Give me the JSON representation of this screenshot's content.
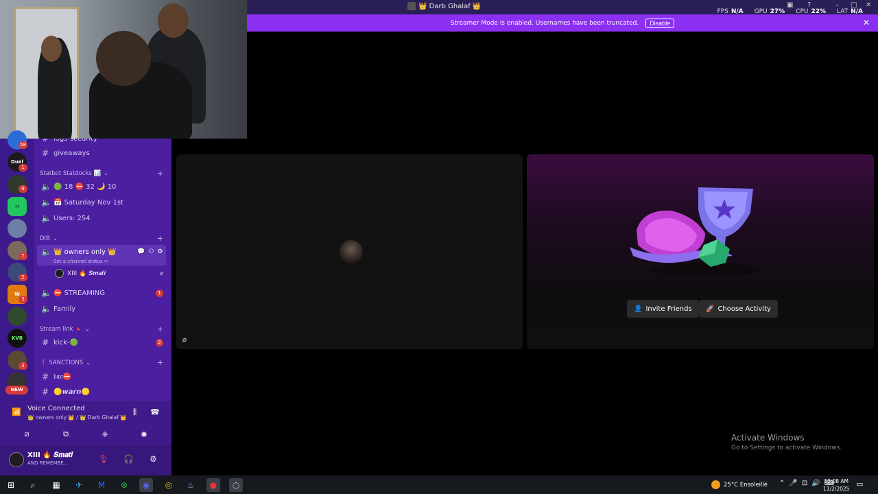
{
  "titlebar": {
    "title": "👑 Darb Ghalaf 👑",
    "stats": [
      {
        "label": "FPS",
        "value": "N/A"
      },
      {
        "label": "GPU",
        "value": "27%"
      },
      {
        "label": "CPU",
        "value": "22%"
      },
      {
        "label": "LAT",
        "value": "N/A"
      }
    ]
  },
  "streamer_mode": {
    "message": "Streamer Mode is enabled. Usernames have been truncated.",
    "disable_label": "Disable"
  },
  "servers": [
    {
      "label": "",
      "badge": "58"
    },
    {
      "label": "Duel",
      "badge": "1"
    },
    {
      "label": "",
      "badge": "9"
    },
    {
      "label": "H",
      "badge": ""
    },
    {
      "label": "",
      "badge": ""
    },
    {
      "label": "",
      "badge": "7"
    },
    {
      "label": "",
      "badge": "2"
    },
    {
      "label": "W",
      "badge": "3"
    },
    {
      "label": "",
      "badge": ""
    },
    {
      "label": "KVB",
      "badge": ""
    },
    {
      "label": "",
      "badge": "3"
    },
    {
      "label": "",
      "badge": ""
    }
  ],
  "new_badge": "NEW",
  "channels": {
    "top_cut": "logs-security",
    "giveaways": "giveaways",
    "cat_statbot": "Statbot Statdocks 📊",
    "statbot_counts": "🟢 18 ⛔ 32 🌙 10",
    "date": "📅 Saturday Nov 1st",
    "users": "Users: 254",
    "cat_dib": "DIB",
    "owners_only": "👑 owners only 👑",
    "status_hint": "Set a channel status ✏",
    "voice_user": "XIII 🔥 𝑺𝒎𝒂𝒕𝒊",
    "streaming": "⛔ STREAMING",
    "streaming_badge": "1",
    "family": "Family",
    "cat_stream": "Stream link 🔺",
    "kick": "kick-🟢",
    "kick_badge": "2",
    "cat_sanctions": "❗ SANCTIONS",
    "ban": "𝔟𝔞𝔫⛔",
    "warn": "🟡𝙬𝙖𝙧𝙣🟡"
  },
  "voice_panel": {
    "title": "Voice Connected",
    "subtitle": "👑 owners only 👑 / 👑 Darb Ghalaf 👑"
  },
  "user_panel": {
    "name": "XIII 🔥 𝑺𝒎𝒂𝒕𝒊",
    "sub": "AND REMEMBE..."
  },
  "activity": {
    "invite_label": "Invite Friends",
    "choose_label": "Choose Activity"
  },
  "watermark": {
    "title": "Activate Windows",
    "subtitle": "Go to Settings to activate Windows."
  },
  "taskbar": {
    "weather": "25°C  Ensoleillé",
    "time": "12:08 AM",
    "date": "11/2/2025"
  },
  "colors": {
    "streamer_bar": "#8b2ff0",
    "sidebar": "#4b1fa0",
    "server_strip": "#3d1a8c",
    "badge_red": "#d83a3a"
  }
}
